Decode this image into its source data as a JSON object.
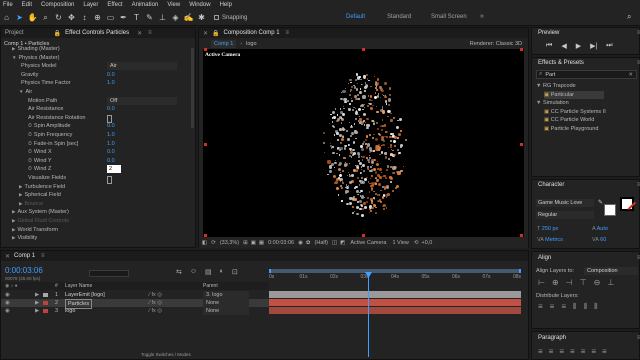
{
  "menu": [
    "File",
    "Edit",
    "Composition",
    "Layer",
    "Effect",
    "Animation",
    "View",
    "Window",
    "Help"
  ],
  "toolbar": {
    "snapping": "Snapping",
    "workspaces": [
      "Default",
      "Standard",
      "Small Screen"
    ],
    "active_workspace": "Default",
    "search_icon": "search-icon"
  },
  "left_panel": {
    "tabs": [
      "Project",
      "Effect Controls Particles"
    ],
    "breadcrumb": "Comp 1 • Particles",
    "rows": [
      {
        "label": "Shading (Master)",
        "indent": 1,
        "type": "group"
      },
      {
        "label": "Physics (Master)",
        "indent": 1,
        "type": "group-open"
      },
      {
        "label": "Physics Model",
        "indent": 2,
        "type": "value",
        "value": "Air"
      },
      {
        "label": "Gravity",
        "indent": 2,
        "type": "value",
        "value": "0.0"
      },
      {
        "label": "Physics Time Factor",
        "indent": 2,
        "type": "value",
        "value": "1.0"
      },
      {
        "label": "Air",
        "indent": 2,
        "type": "group-open"
      },
      {
        "label": "Motion Path",
        "indent": 3,
        "type": "value",
        "value": "Off"
      },
      {
        "label": "Air Resistance",
        "indent": 3,
        "type": "value",
        "value": "0.0"
      },
      {
        "label": "Air Resistance Rotation",
        "indent": 3,
        "type": "check"
      },
      {
        "label": "Spin Amplitude",
        "indent": 3,
        "type": "value",
        "value": "0.0"
      },
      {
        "label": "Spin Frequency",
        "indent": 3,
        "type": "value",
        "value": "1.0"
      },
      {
        "label": "Fade-in Spin [sec]",
        "indent": 3,
        "type": "value",
        "value": "1.0"
      },
      {
        "label": "Wind X",
        "indent": 3,
        "type": "value",
        "value": "0.0"
      },
      {
        "label": "Wind Y",
        "indent": 3,
        "type": "value",
        "value": "0.0"
      },
      {
        "label": "Wind Z",
        "indent": 3,
        "type": "input",
        "value": "2"
      },
      {
        "label": "Visualize Fields",
        "indent": 3,
        "type": "check"
      },
      {
        "label": "Turbulence Field",
        "indent": 2,
        "type": "group"
      },
      {
        "label": "Spherical Field",
        "indent": 2,
        "type": "group"
      },
      {
        "label": "Bounce",
        "indent": 2,
        "type": "group-dim"
      },
      {
        "label": "Aux System (Master)",
        "indent": 1,
        "type": "group"
      },
      {
        "label": "Global Fluid Controls",
        "indent": 1,
        "type": "group-dim"
      },
      {
        "label": "World Transform",
        "indent": 1,
        "type": "group"
      },
      {
        "label": "Visibility",
        "indent": 1,
        "type": "group"
      }
    ]
  },
  "composition": {
    "title": "Composition Comp 1",
    "tab": "Comp 1",
    "breadcrumb": "logo",
    "renderer": "Renderer: Classic 3D",
    "camera_label": "Active Camera",
    "zoom": "(33,3%)",
    "timecode": "0:00:03:06",
    "resolution": "(Half)",
    "view_camera": "Active Camera",
    "views": "1 View"
  },
  "preview": {
    "title": "Preview"
  },
  "effects_presets": {
    "title": "Effects & Presets",
    "search_value": "Part",
    "items": [
      {
        "label": "RG Trapcode",
        "indent": 0,
        "type": "folder"
      },
      {
        "label": "Particular",
        "indent": 1,
        "type": "item",
        "selected": true
      },
      {
        "label": "Simulation",
        "indent": 0,
        "type": "folder"
      },
      {
        "label": "CC Particle Systems II",
        "indent": 1,
        "type": "item"
      },
      {
        "label": "CC Particle World",
        "indent": 1,
        "type": "item"
      },
      {
        "label": "Particle Playground",
        "indent": 1,
        "type": "item"
      }
    ]
  },
  "character": {
    "title": "Character",
    "font": "Game Music Love",
    "style": "Regular",
    "size": "250 px",
    "leading": "Auto",
    "kerning": "Metrics",
    "tracking": "60"
  },
  "timeline": {
    "tab": "Comp 1",
    "timecode": "0:00:03:06",
    "frames": "00078 (25.00 fps)",
    "col_layer_name": "Layer Name",
    "col_parent": "Parent",
    "ruler": [
      "0s",
      "01s",
      "02s",
      "03s",
      "04s",
      "05s",
      "06s",
      "07s",
      "08s"
    ],
    "layers": [
      {
        "num": "1",
        "name": "LayerEmit [logo]",
        "parent": "3. logo",
        "color": "#a9a9a9"
      },
      {
        "num": "2",
        "name": "Particles",
        "parent": "None",
        "color": "#b7463d",
        "selected": true
      },
      {
        "num": "3",
        "name": "logo",
        "parent": "None",
        "color": "#b7463d"
      }
    ],
    "footer": "Toggle Switches / Modes"
  },
  "align": {
    "title": "Align",
    "align_to_label": "Align Layers to:",
    "align_to_value": "Composition",
    "distribute": "Distribute Layers:"
  },
  "paragraph": {
    "title": "Paragraph"
  },
  "colors": {
    "accent": "#3fa0ff",
    "bar_red": "#b7463d",
    "bar_grey": "#a9a9a9",
    "handle": "#d0321e"
  }
}
